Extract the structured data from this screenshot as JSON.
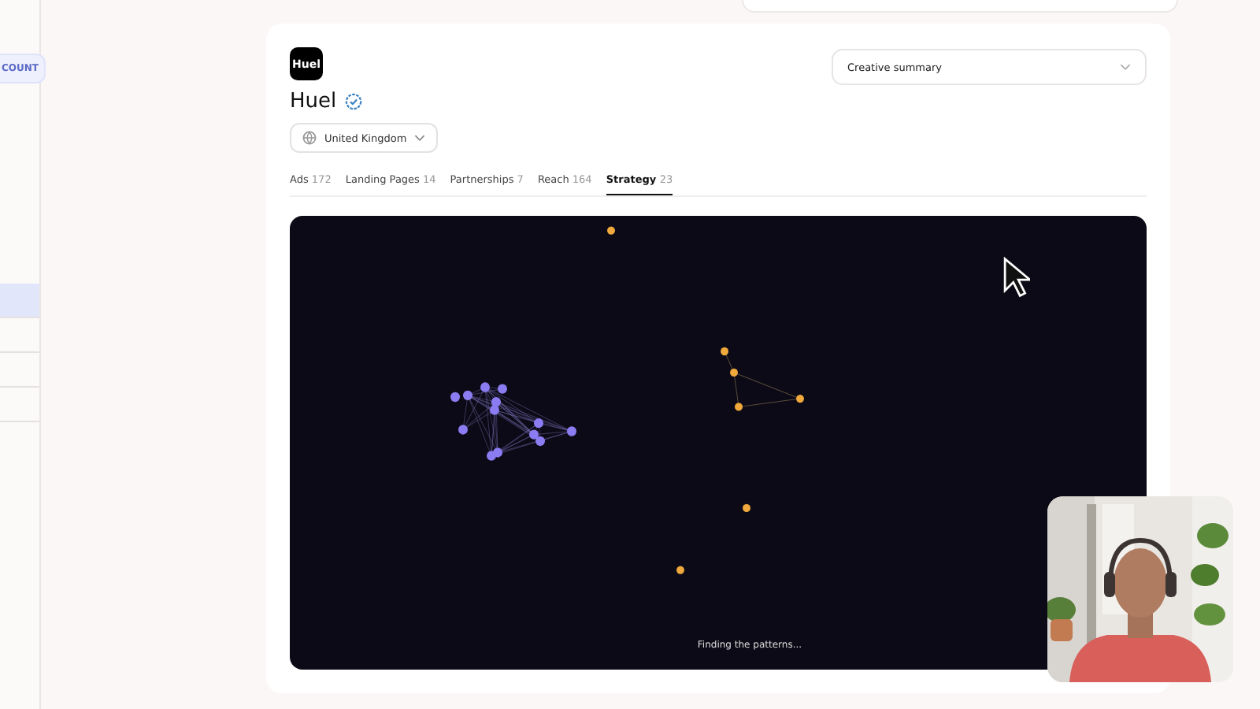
{
  "sidebar": {
    "badge": "COUNT",
    "items": [
      {
        "selected": true
      },
      {
        "selected": false
      },
      {
        "selected": false
      },
      {
        "selected": false
      }
    ]
  },
  "brand": {
    "logo": "Huel",
    "name": "Huel",
    "verified": true
  },
  "country": {
    "label": "United Kingdom"
  },
  "summary_select": {
    "value": "Creative summary"
  },
  "tabs": [
    {
      "label": "Ads",
      "count": "172",
      "selected": false
    },
    {
      "label": "Landing Pages",
      "count": "14",
      "selected": false
    },
    {
      "label": "Partnerships",
      "count": "7",
      "selected": false
    },
    {
      "label": "Reach",
      "count": "164",
      "selected": false
    },
    {
      "label": "Strategy",
      "count": "23",
      "selected": true
    }
  ],
  "graph": {
    "status": "Finding the patterns..."
  }
}
